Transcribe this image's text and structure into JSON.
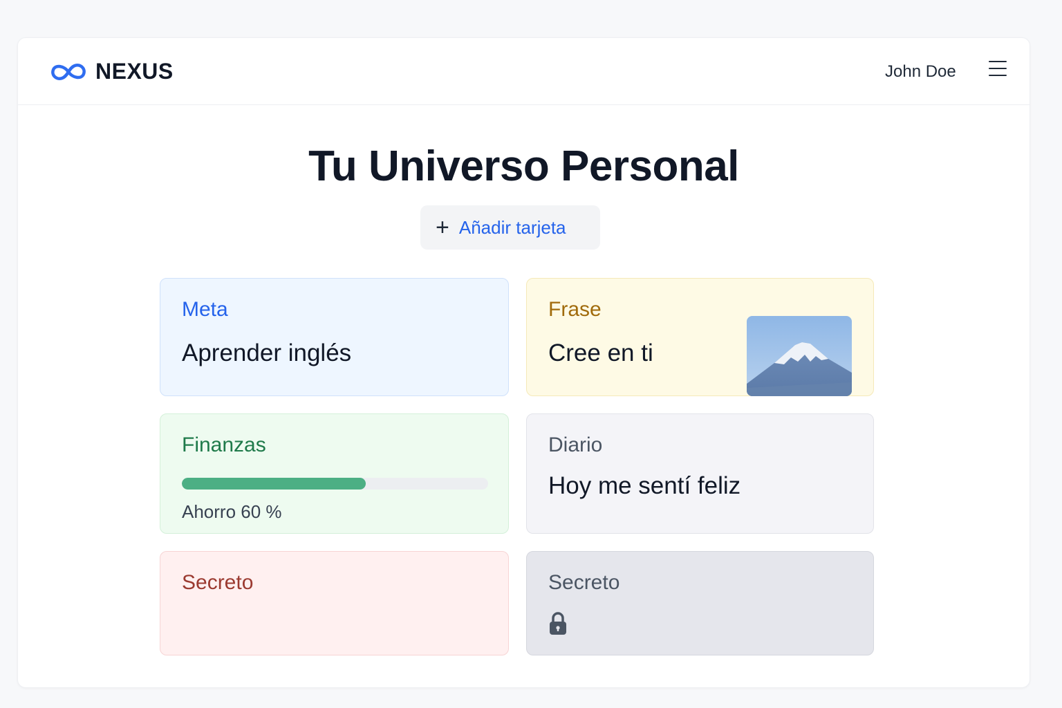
{
  "header": {
    "brand": "NEXUS",
    "logo_icon": "infinity-icon",
    "user_name": "John Doe",
    "menu_icon": "hamburger-menu-icon"
  },
  "main": {
    "title": "Tu Universo Personal",
    "add_button": {
      "icon": "plus-icon",
      "label": "Añadir tarjeta"
    }
  },
  "cards": {
    "meta": {
      "title": "Meta",
      "text": "Aprender inglés"
    },
    "frase": {
      "title": "Frase",
      "text": "Cree en ti",
      "image": "mountain-photo"
    },
    "finanzas": {
      "title": "Finanzas",
      "progress_percent": 60,
      "label": "Ahorro 60 %"
    },
    "diario": {
      "title": "Diario",
      "text": "Hoy me sentí feliz"
    },
    "secreto1": {
      "title": "Secreto"
    },
    "secreto2": {
      "title": "Secreto",
      "icon": "lock-icon"
    }
  },
  "colors": {
    "accent": "#2563eb",
    "progress": "#4caf84"
  }
}
